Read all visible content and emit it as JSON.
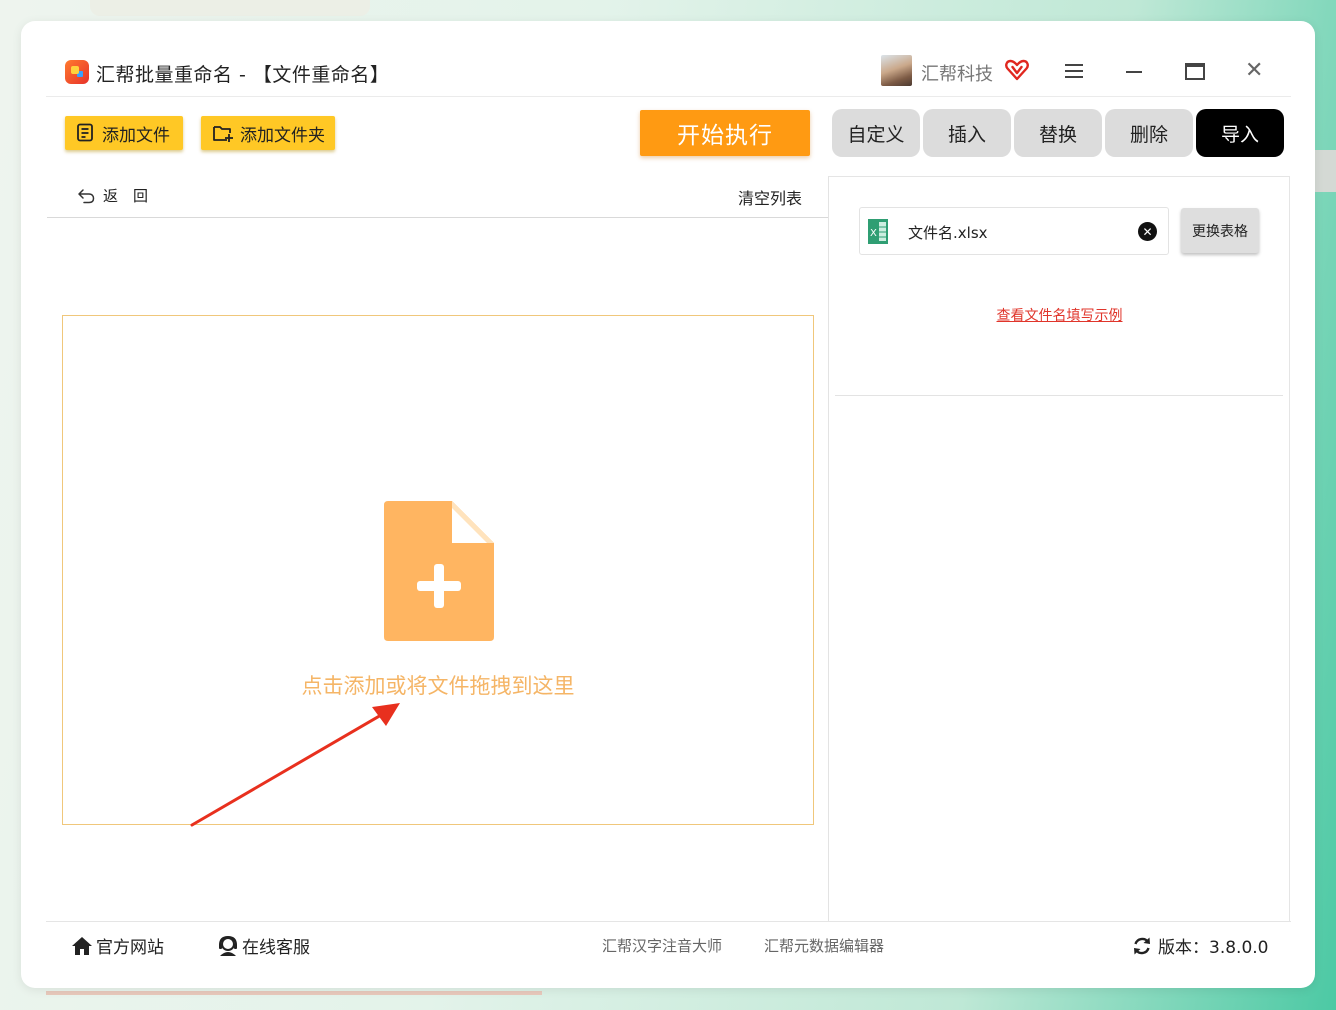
{
  "window": {
    "title": "汇帮批量重命名 - 【文件重命名】",
    "brand_name": "汇帮科技"
  },
  "toolbar": {
    "add_file_label": "添加文件",
    "add_folder_label": "添加文件夹",
    "start_label": "开始执行",
    "tabs": [
      {
        "label": "自定义",
        "active": false
      },
      {
        "label": "插入",
        "active": false
      },
      {
        "label": "替换",
        "active": false
      },
      {
        "label": "删除",
        "active": false
      },
      {
        "label": "导入",
        "active": true
      }
    ]
  },
  "left_panel": {
    "back_label": "返　回",
    "clear_label": "清空列表",
    "drop_text": "点击添加或将文件拖拽到这里"
  },
  "right_panel": {
    "file_name": "文件名.xlsx",
    "replace_label": "更换表格",
    "example_link": "查看文件名填写示例"
  },
  "footer": {
    "site_label": "官方网站",
    "service_label": "在线客服",
    "link_hanzi": "汇帮汉字注音大师",
    "link_meta": "汇帮元数据编辑器",
    "version_label": "版本：3.8.0.0"
  },
  "colors": {
    "accent_yellow": "#ffc825",
    "start_orange": "#ff9a12",
    "drop_border": "#f0c77b",
    "drop_text": "#f5b566",
    "link_red": "#e0352b",
    "tab_active": "#000000",
    "tab_inactive": "#dcdcdc"
  },
  "icons": {
    "app_logo": "app-logo-icon",
    "vip": "heart-vip-icon",
    "menu": "hamburger-menu-icon",
    "minimize": "minimize-icon",
    "maximize": "maximize-icon",
    "close": "close-icon",
    "add_file": "add-file-icon",
    "add_folder": "add-folder-icon",
    "back": "back-arrow-icon",
    "file_plus": "file-plus-icon",
    "excel": "excel-icon",
    "clear_file": "clear-circle-icon",
    "home": "home-icon",
    "service": "customer-service-icon",
    "refresh": "refresh-icon"
  }
}
